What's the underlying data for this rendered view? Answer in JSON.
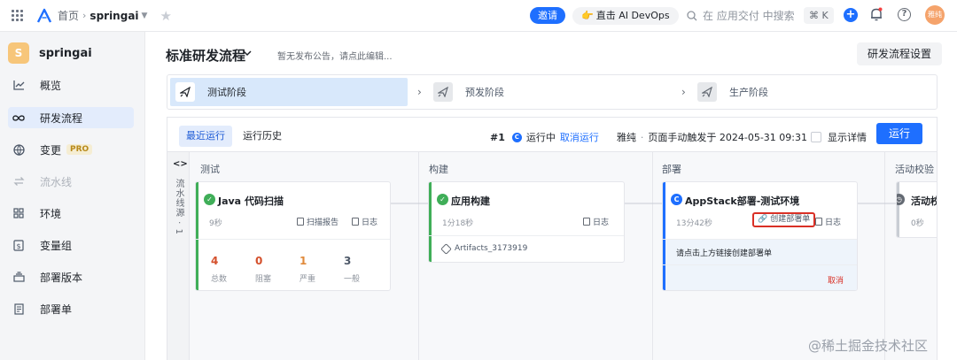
{
  "topbar": {
    "breadcrumb_home": "首页",
    "breadcrumb_project": "springai",
    "invite_label": "邀请",
    "devops_label": "直击 AI DevOps",
    "search_placeholder": "在 应用交付 中搜索",
    "shortcut": "⌘ K",
    "avatar_text": "雅纯"
  },
  "sidebar": {
    "project_initial": "S",
    "project_name": "springai",
    "items": [
      {
        "label": "概览",
        "icon": "chart-line-icon"
      },
      {
        "label": "研发流程",
        "icon": "infinity-icon",
        "active": true
      },
      {
        "label": "变更",
        "icon": "globe-icon",
        "badge": "PRO"
      },
      {
        "label": "流水线",
        "icon": "arrows-icon",
        "disabled": true
      },
      {
        "label": "环境",
        "icon": "grid-icon"
      },
      {
        "label": "变量组",
        "icon": "dollar-icon"
      },
      {
        "label": "部署版本",
        "icon": "stack-icon"
      },
      {
        "label": "部署单",
        "icon": "document-icon"
      }
    ]
  },
  "main": {
    "title": "标准研发流程",
    "notice": "暂无发布公告，请点此编辑...",
    "settings_label": "研发流程设置",
    "stages": [
      {
        "label": "测试阶段",
        "active": true
      },
      {
        "label": "预发阶段"
      },
      {
        "label": "生产阶段"
      }
    ],
    "run_tabs": [
      {
        "label": "最近运行",
        "active": true
      },
      {
        "label": "运行历史"
      }
    ],
    "run": {
      "number": "#1",
      "status": "运行中",
      "cancel": "取消运行",
      "user": "雅纯",
      "trigger": "页面手动触发于 2024-05-31 09:31",
      "show_detail": "显示详情",
      "run_button": "运行"
    },
    "rail_label": "流水线源 · 1",
    "columns": [
      "测试",
      "构建",
      "部署",
      "活动校验"
    ],
    "cards": {
      "scan": {
        "title": "Java 代码扫描",
        "duration": "9秒",
        "report": "扫描报告",
        "log": "日志",
        "metrics": [
          {
            "value": "4",
            "label": "总数",
            "color": "#d4502c"
          },
          {
            "value": "0",
            "label": "阻塞",
            "color": "#d4502c"
          },
          {
            "value": "1",
            "label": "严重",
            "color": "#e08a3c"
          },
          {
            "value": "3",
            "label": "一般",
            "color": "#4e5969"
          }
        ]
      },
      "build": {
        "title": "应用构建",
        "duration": "1分18秒",
        "log": "日志",
        "artifact": "Artifacts_3173919"
      },
      "deploy": {
        "title": "AppStack部署-测试环境",
        "duration": "13分42秒",
        "create_order": "创建部署单",
        "log": "日志",
        "hint": "请点击上方链接创建部署单",
        "cancel": "取消"
      },
      "check": {
        "title": "活动校",
        "duration": "0秒"
      }
    },
    "colors": {
      "primary": "#1e6fff",
      "success": "#3fae58",
      "running": "#1e6fff",
      "warning": "#d93026"
    }
  },
  "watermark": "@稀土掘金技术社区"
}
